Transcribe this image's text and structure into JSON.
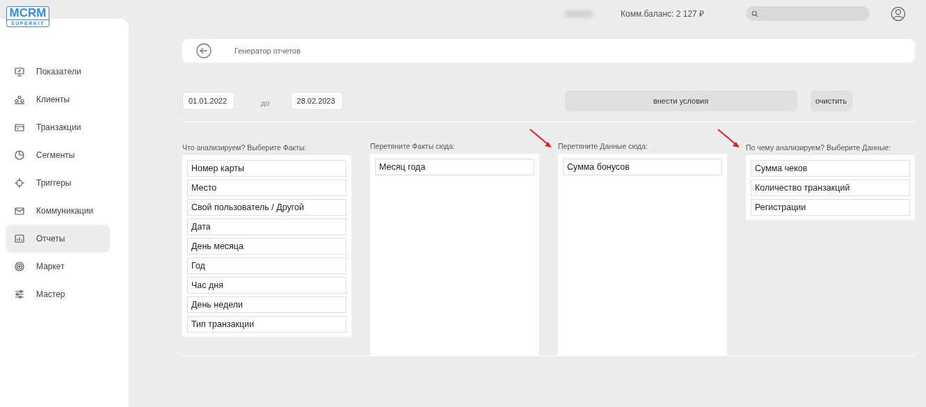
{
  "logo": {
    "title": "MCRM",
    "subtitle": "SUPERKIT"
  },
  "sidebar": {
    "items": [
      {
        "label": "Показатели",
        "selected": false
      },
      {
        "label": "Клиенты",
        "selected": false
      },
      {
        "label": "Транзакции",
        "selected": false
      },
      {
        "label": "Сегменты",
        "selected": false
      },
      {
        "label": "Триггеры",
        "selected": false
      },
      {
        "label": "Коммуникации",
        "selected": false
      },
      {
        "label": "Отчеты",
        "selected": true
      },
      {
        "label": "Маркет",
        "selected": false
      },
      {
        "label": "Мастер",
        "selected": false
      }
    ]
  },
  "topbar": {
    "balance": "Комм.баланс: 2 127 ₽"
  },
  "page": {
    "title": "Генератор отчетов"
  },
  "filters": {
    "date_from": "01.01.2022",
    "separator": "до",
    "date_to": "28.02.2023",
    "apply_button": "внести условия",
    "clear_button": "очистить"
  },
  "columns": [
    {
      "title": "Что анализируем? Выберите Факты:",
      "arrow": false,
      "tall": false,
      "items": [
        "Номер карты",
        "Место",
        "Свой пользователь / Другой",
        "Дата",
        "День месяца",
        "Год",
        "Час дня",
        "День недели",
        "Тип транзакции"
      ]
    },
    {
      "title": "Перетяните Факты сюда:",
      "arrow": false,
      "tall": true,
      "items": [
        "Месяц года"
      ]
    },
    {
      "title": "Перетяните Данные сюда:",
      "arrow": true,
      "tall": true,
      "items": [
        "Сумма бонусов"
      ]
    },
    {
      "title": "По чему анализируем? Выберите Данные:",
      "arrow": true,
      "tall": false,
      "items": [
        "Сумма чеков",
        "Количество транзакций",
        "Регистрации"
      ]
    }
  ]
}
